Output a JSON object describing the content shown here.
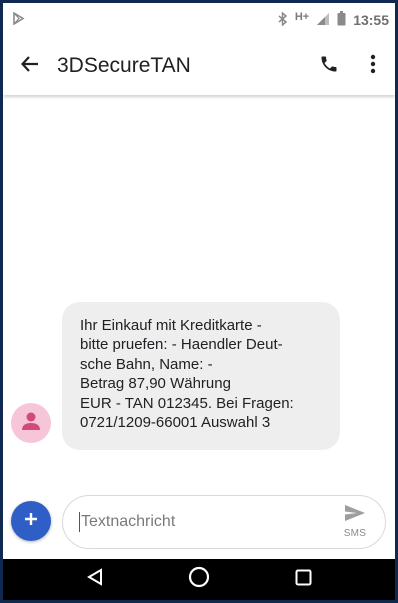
{
  "status_bar": {
    "time": "13:55",
    "network": "H+",
    "icons": [
      "play-store-icon",
      "bluetooth-icon",
      "signal-icon",
      "battery-icon"
    ]
  },
  "app_bar": {
    "title": "3DSecureTAN",
    "icons": [
      "back-arrow-icon",
      "phone-icon",
      "more-vert-icon"
    ]
  },
  "message": {
    "text": "Ihr Einkauf mit Kreditkarte -\nbitte pruefen: - Haendler Deut-\nsche Bahn, Name: -\nBetrag 87,90 Währung\nEUR - TAN 012345. Bei Fragen:\n0721/1209-66001 Auswahl 3",
    "avatar_icon": "person-icon",
    "avatar_color": "#f7c5d8"
  },
  "compose": {
    "placeholder": "Textnachricht",
    "send_label": "SMS",
    "add_icon": "plus-icon",
    "accent": "#2f5ec6"
  },
  "nav_bar": {
    "icons": [
      "back-triangle-icon",
      "home-circle-icon",
      "recents-square-icon"
    ]
  }
}
